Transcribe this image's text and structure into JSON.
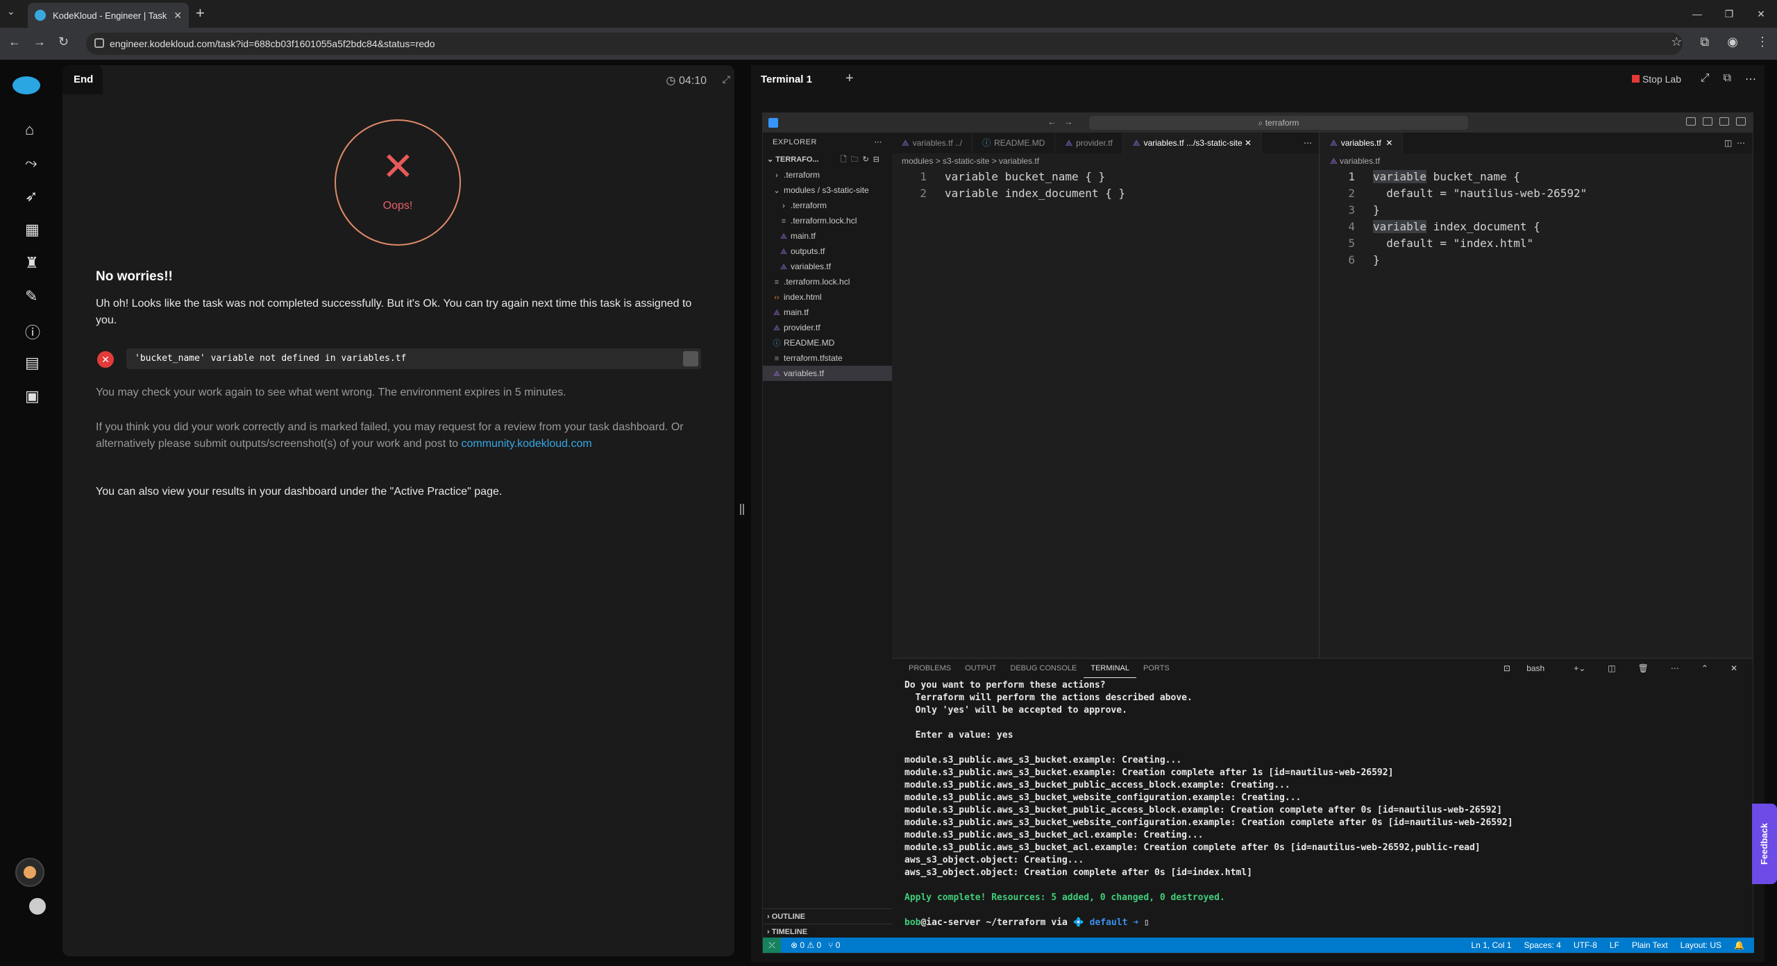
{
  "browser": {
    "tab_title": "KodeKloud - Engineer | Task",
    "url": "engineer.kodekloud.com/task?id=688cb03f1601055a5f2bdc84&status=redo"
  },
  "task": {
    "end_tab": "End",
    "timer": "04:10",
    "oops": "Oops!",
    "no_worries": "No worries!!",
    "uh_oh": "Uh oh! Looks like the task was not completed successfully. But it's Ok. You can try again next time this task is assigned to you.",
    "error": "'bucket_name' variable not defined in variables.tf",
    "may_check": "You may check your work again to see what went wrong. The environment expires in 5 minutes.",
    "review_text": "If you think you did your work correctly and is marked failed, you may request for a review from your task dashboard. Or alternatively please submit outputs/screenshot(s) of your work and post to",
    "community_link": "community.kodekloud.com",
    "view_results": "You can also view your results in your dashboard under the \"Active Practice\" page."
  },
  "terminal_header": {
    "tab": "Terminal 1",
    "stop_lab": "Stop Lab"
  },
  "vscode": {
    "search": "terraform",
    "explorer_title": "EXPLORER",
    "project": "TERRAFO...",
    "files": [
      {
        "name": ".terraform",
        "type": "folder-closed",
        "depth": 1
      },
      {
        "name": "modules / s3-static-site",
        "type": "folder-open",
        "depth": 1
      },
      {
        "name": ".terraform",
        "type": "folder-closed",
        "depth": 2
      },
      {
        "name": ".terraform.lock.hcl",
        "type": "lock",
        "depth": 2
      },
      {
        "name": "main.tf",
        "type": "tf",
        "depth": 2
      },
      {
        "name": "outputs.tf",
        "type": "tf",
        "depth": 2
      },
      {
        "name": "variables.tf",
        "type": "tf",
        "depth": 2
      },
      {
        "name": ".terraform.lock.hcl",
        "type": "lock",
        "depth": 1
      },
      {
        "name": "index.html",
        "type": "html",
        "depth": 1
      },
      {
        "name": "main.tf",
        "type": "tf",
        "depth": 1
      },
      {
        "name": "provider.tf",
        "type": "tf",
        "depth": 1
      },
      {
        "name": "README.MD",
        "type": "info",
        "depth": 1
      },
      {
        "name": "terraform.tfstate",
        "type": "lock",
        "depth": 1
      },
      {
        "name": "variables.tf",
        "type": "tf",
        "depth": 1,
        "selected": true
      }
    ],
    "outline": "OUTLINE",
    "timeline": "TIMELINE",
    "editor1": {
      "tabs": [
        {
          "label": "variables.tf ../",
          "icon": "tf",
          "active": false
        },
        {
          "label": "README.MD",
          "icon": "info",
          "active": false
        },
        {
          "label": "provider.tf",
          "icon": "tf",
          "active": false
        },
        {
          "label": "variables.tf .../s3-static-site",
          "icon": "tf",
          "active": true
        }
      ],
      "breadcrumb": "modules > s3-static-site > variables.tf",
      "lines": [
        "variable bucket_name { }",
        "variable index_document { }"
      ]
    },
    "editor2": {
      "tab": "variables.tf",
      "breadcrumb": "variables.tf",
      "lines": [
        {
          "kw": "variable",
          "rest": " bucket_name {",
          "str": ""
        },
        {
          "kw": "",
          "rest": "  default = ",
          "str": "\"nautilus-web-26592\""
        },
        {
          "kw": "",
          "rest": "}",
          "str": ""
        },
        {
          "kw": "variable",
          "rest": " index_document {",
          "str": ""
        },
        {
          "kw": "",
          "rest": "  default = ",
          "str": "\"index.html\""
        },
        {
          "kw": "",
          "rest": "}",
          "str": ""
        }
      ]
    },
    "panel_tabs": [
      "PROBLEMS",
      "OUTPUT",
      "DEBUG CONSOLE",
      "TERMINAL",
      "PORTS"
    ],
    "shell": "bash",
    "terminal_lines": [
      "Do you want to perform these actions?",
      "  Terraform will perform the actions described above.",
      "  Only 'yes' will be accepted to approve.",
      "",
      "  Enter a value: yes",
      "",
      "module.s3_public.aws_s3_bucket.example: Creating...",
      "module.s3_public.aws_s3_bucket.example: Creation complete after 1s [id=nautilus-web-26592]",
      "module.s3_public.aws_s3_bucket_public_access_block.example: Creating...",
      "module.s3_public.aws_s3_bucket_website_configuration.example: Creating...",
      "module.s3_public.aws_s3_bucket_public_access_block.example: Creation complete after 0s [id=nautilus-web-26592]",
      "module.s3_public.aws_s3_bucket_website_configuration.example: Creation complete after 0s [id=nautilus-web-26592]",
      "module.s3_public.aws_s3_bucket_acl.example: Creating...",
      "module.s3_public.aws_s3_bucket_acl.example: Creation complete after 0s [id=nautilus-web-26592,public-read]",
      "aws_s3_object.object: Creating...",
      "aws_s3_object.object: Creation complete after 0s [id=index.html]",
      ""
    ],
    "apply_complete": "Apply complete! Resources: 5 added, 0 changed, 0 destroyed.",
    "prompt_user": "bob",
    "prompt_host": "@iac-server",
    "prompt_path": " ~/terraform via ",
    "prompt_ws": "💠 default ➜ ",
    "status": {
      "errors": "0",
      "warnings": "0",
      "ports": "0",
      "position": "Ln 1, Col 1",
      "spaces": "Spaces: 4",
      "encoding": "UTF-8",
      "eol": "LF",
      "lang": "Plain Text",
      "layout": "Layout: US"
    }
  },
  "feedback": "Feedback"
}
